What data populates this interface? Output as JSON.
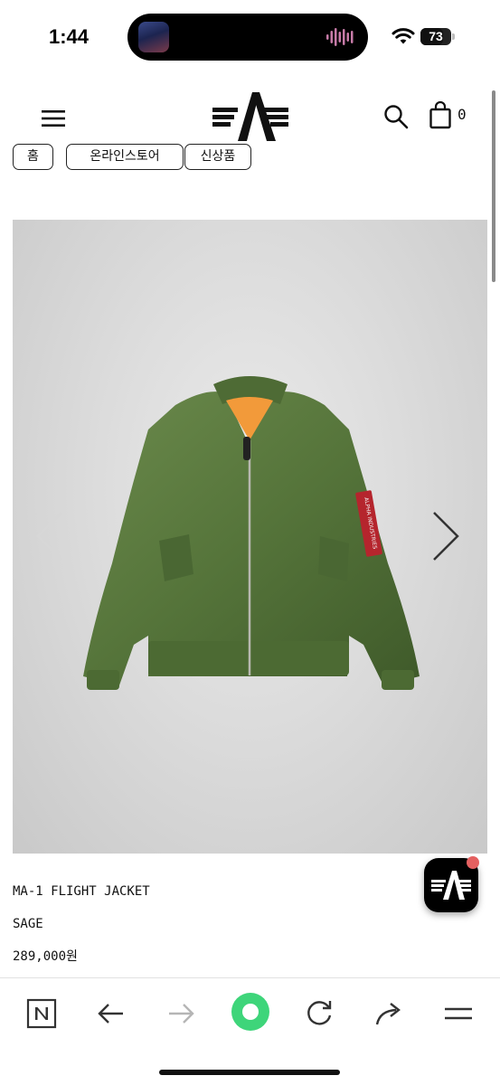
{
  "status_bar": {
    "time": "1:44",
    "battery_level": "73",
    "battery_fraction": 0.73
  },
  "header": {
    "menu_icon": "hamburger-menu-icon",
    "logo": "alpha-industries-logo",
    "search_icon": "search-icon",
    "cart_icon": "shopping-bag-icon",
    "cart_count": "0"
  },
  "breadcrumb": [
    "홈",
    "온라인스토어",
    "신상품"
  ],
  "product": {
    "image": "olive-green-flight-jacket-photo",
    "sleeve_patch_text": "ALPHA INDUSTRIES",
    "name": "MA-1 FLIGHT JACKET",
    "color": "SAGE",
    "price": "289,000원"
  },
  "floating_button": {
    "icon": "alpha-industries-logo",
    "has_notification": true
  },
  "toolbar": {
    "buttons": [
      "naver-n-icon",
      "back-arrow-icon",
      "forward-arrow-icon",
      "green-dot-icon",
      "reload-icon",
      "share-icon",
      "menu-icon"
    ]
  },
  "colors": {
    "accent_green": "#3ed57a",
    "jacket_green": "#5a7a3e",
    "notification_red": "#e46060"
  }
}
